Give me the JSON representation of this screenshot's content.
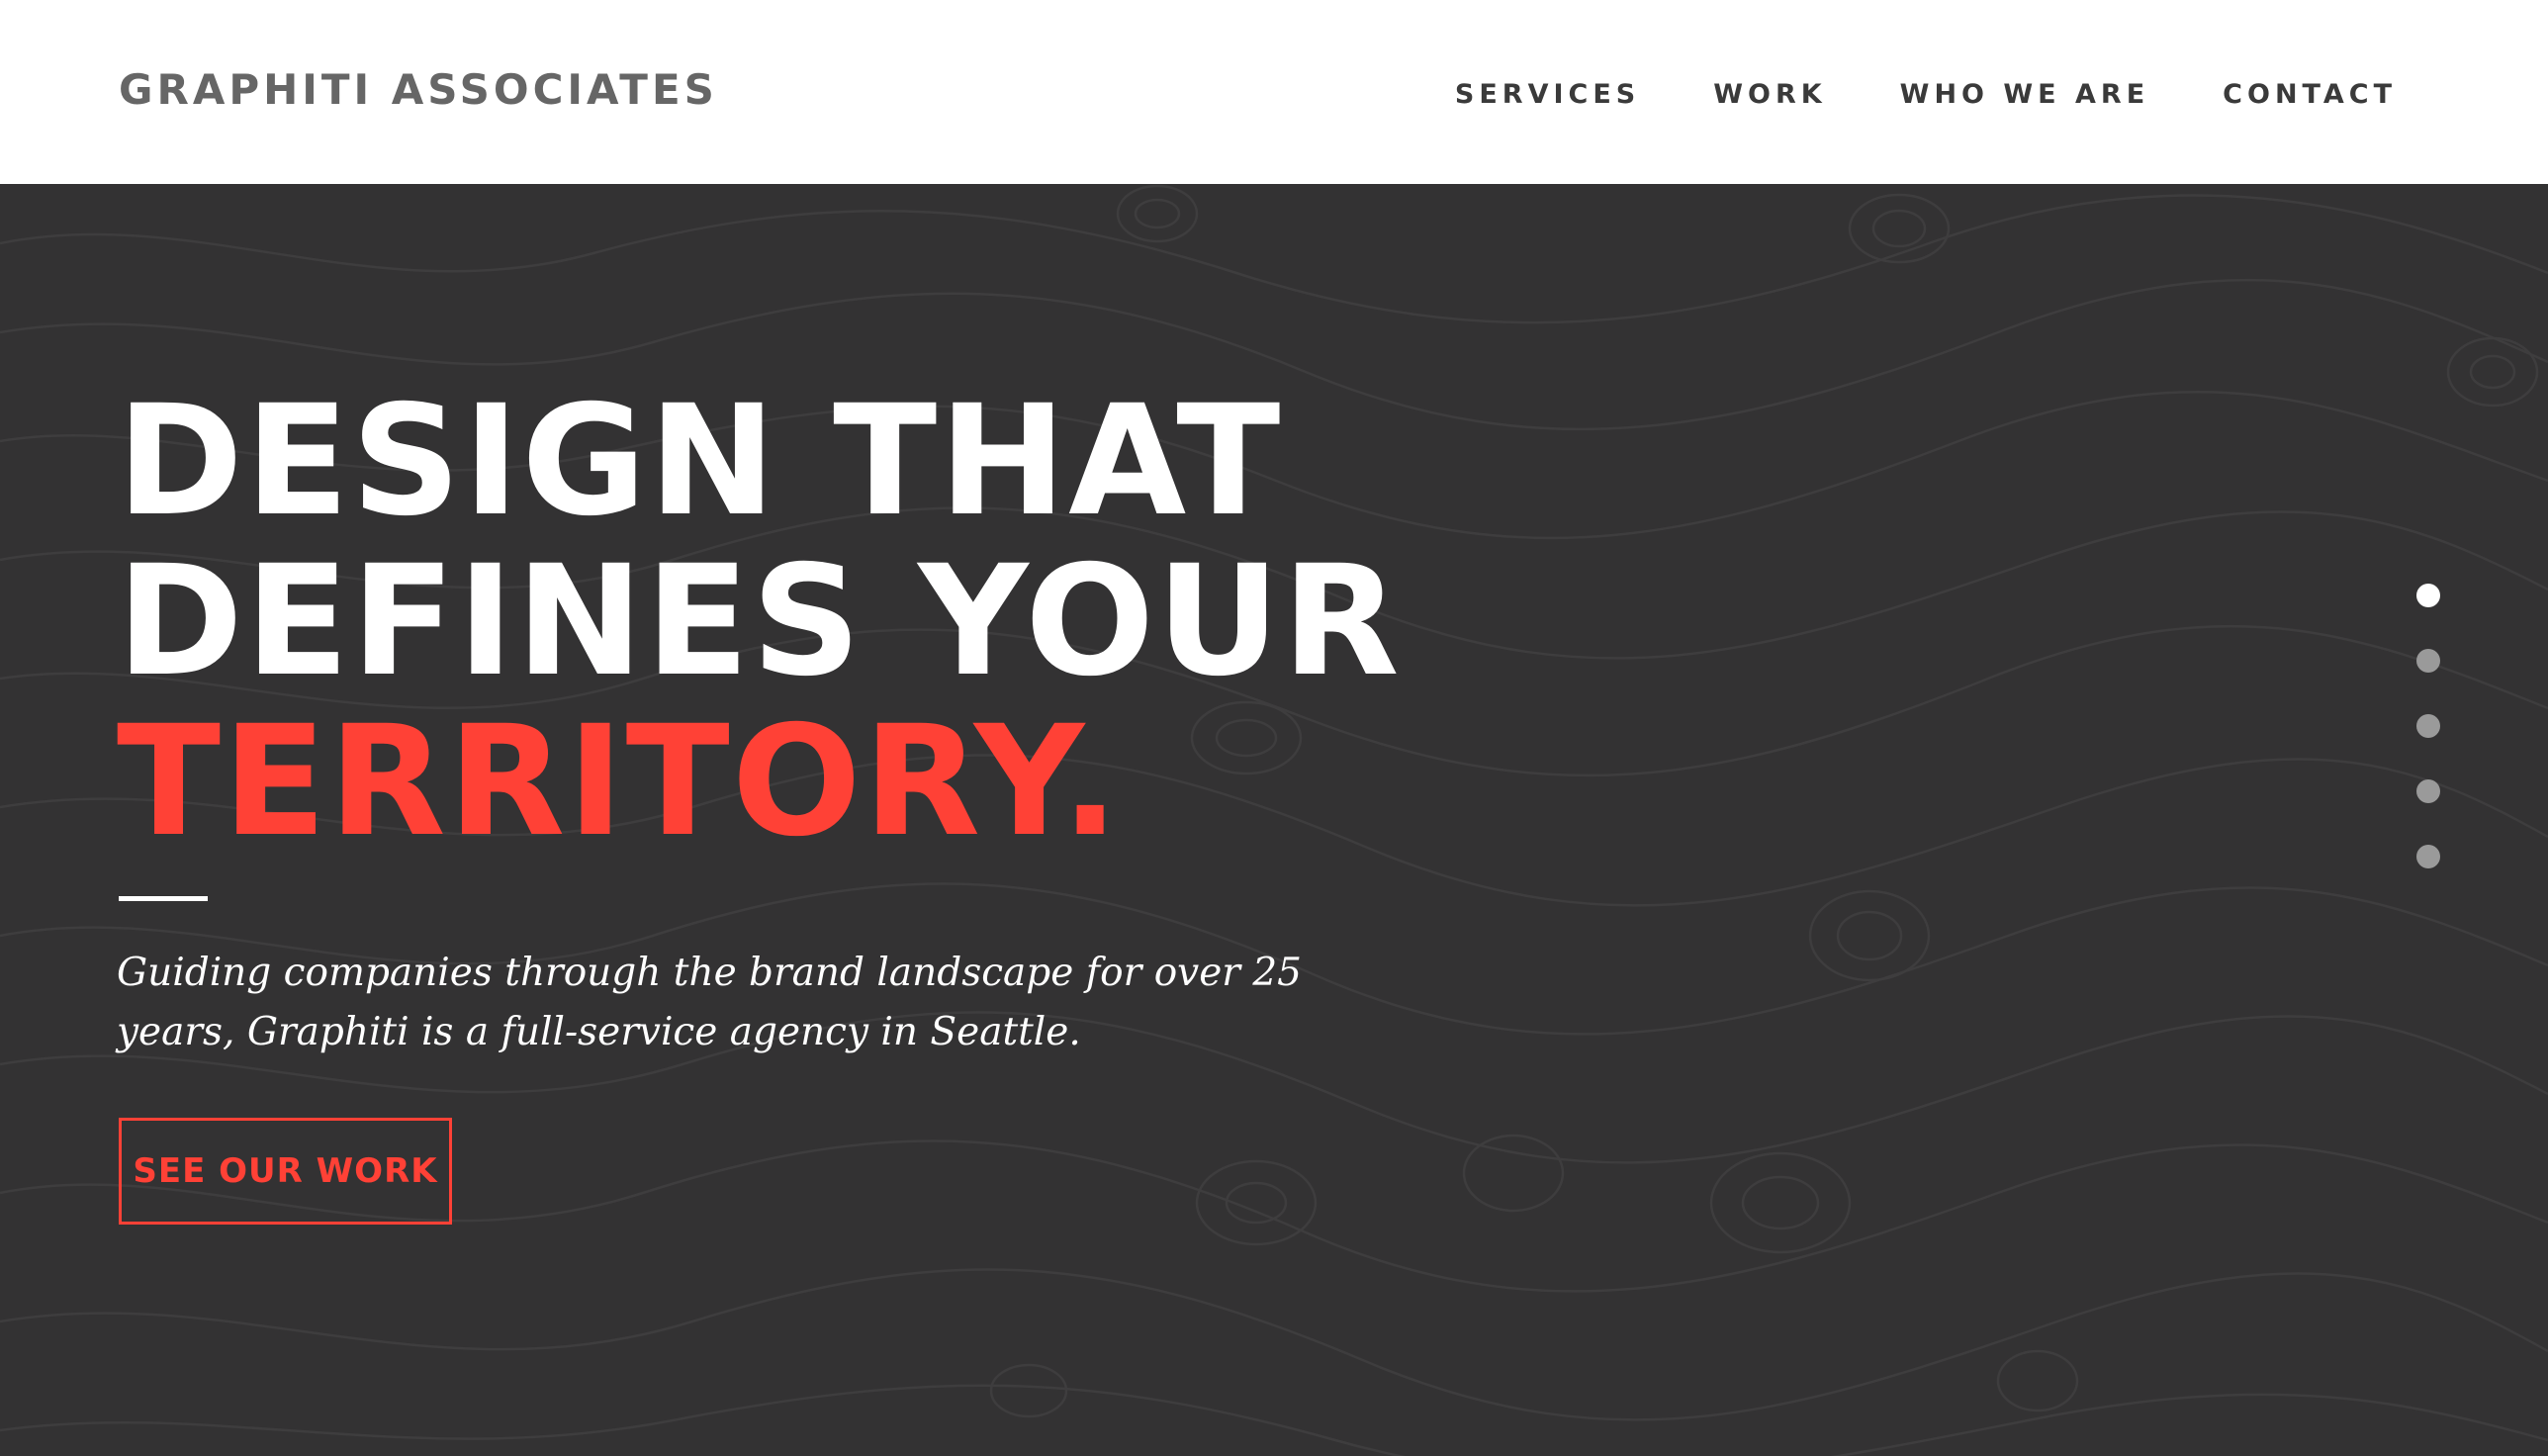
{
  "brand": {
    "name": "GRAPHITI ASSOCIATES"
  },
  "nav": {
    "items": [
      {
        "label": "SERVICES"
      },
      {
        "label": "WORK"
      },
      {
        "label": "WHO WE ARE"
      },
      {
        "label": "CONTACT"
      }
    ]
  },
  "hero": {
    "headline": {
      "line1": "DESIGN THAT",
      "line2": "DEFINES YOUR",
      "line3": "TERRITORY."
    },
    "subtitle": "Guiding companies through the brand landscape for over 25 years, Graphiti is a full-service agency in Seattle.",
    "cta_label": "SEE OUR WORK",
    "slides": {
      "count": 5,
      "active_index": 0
    }
  },
  "colors": {
    "header_bg": "#ffffff",
    "hero_bg": "#333233",
    "accent": "#ff4136",
    "headline_text": "#ffffff",
    "nav_text": "#3a3a3a",
    "logo_text": "#666666",
    "dot_inactive": "#9a9a9a",
    "dot_active": "#ffffff"
  }
}
